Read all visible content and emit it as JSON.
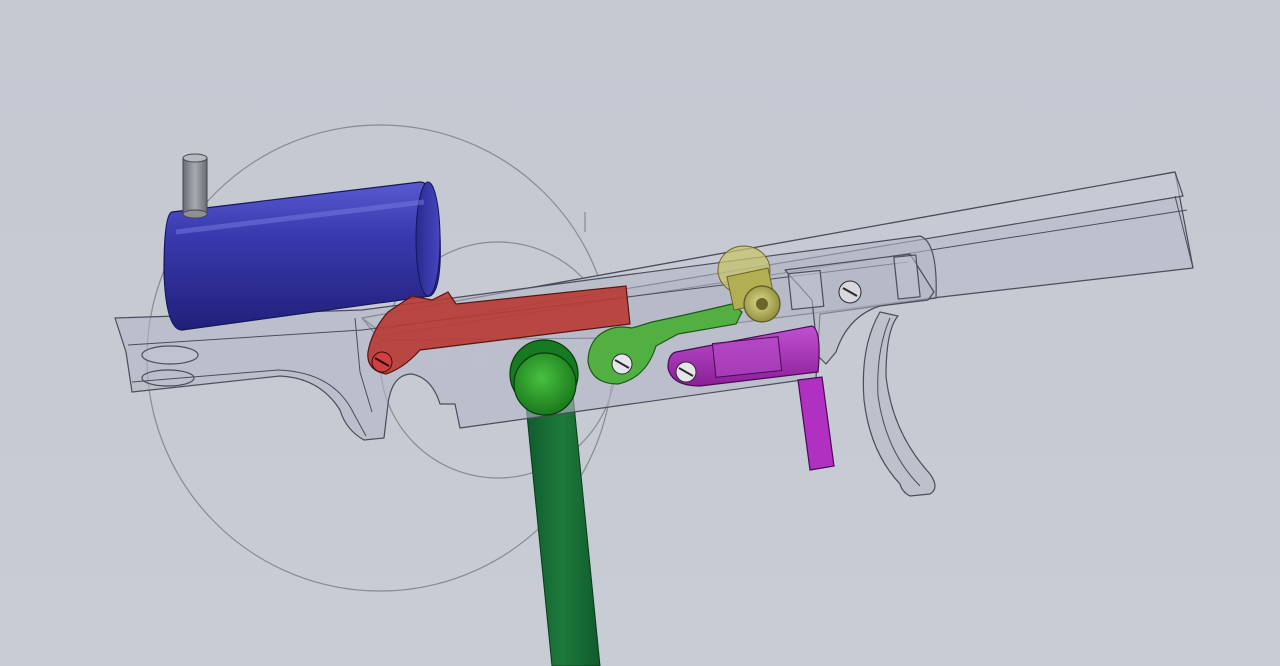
{
  "view": {
    "background_color": "#c5c9d2",
    "render_style": "shaded-with-transparent-housing"
  },
  "colors": {
    "housing_fill": "#b4b8c6",
    "housing_edge": "#4a4d5a",
    "cylinder": "#3a3aa6",
    "cylinder_pin": "#8e9098",
    "red_lever": "#b8322e",
    "green_rod": "#1f7a3a",
    "green_lever": "#4aa83e",
    "green_knob": "#2f9a2a",
    "brass_spring": "#b8b45a",
    "magenta_part": "#a52db8",
    "sketch_circle": "#8a8a8e"
  },
  "parts": [
    {
      "name": "receiver-housing",
      "color_key": "housing_fill"
    },
    {
      "name": "blue-cylinder",
      "color_key": "cylinder"
    },
    {
      "name": "red-sear-lever",
      "color_key": "red_lever"
    },
    {
      "name": "green-hammer-strut",
      "color_key": "green_rod"
    },
    {
      "name": "green-disconnector-lever",
      "color_key": "green_lever"
    },
    {
      "name": "brass-spring-plug",
      "color_key": "brass_spring"
    },
    {
      "name": "magenta-trigger-bar",
      "color_key": "magenta_part"
    },
    {
      "name": "trigger-blade",
      "color_key": "housing_fill"
    }
  ]
}
